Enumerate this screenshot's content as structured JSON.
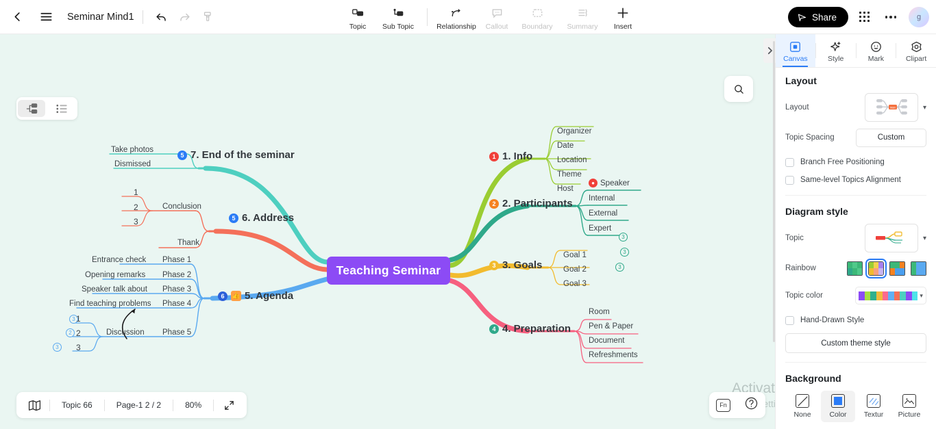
{
  "topbar": {
    "doc_title": "Seminar Mind1",
    "back_icon": "back-arrow-icon",
    "menu_icon": "hamburger-icon",
    "undo_icon": "undo-icon",
    "redo_icon": "redo-icon",
    "brush_icon": "format-painter-icon",
    "tools": [
      {
        "label": "Topic",
        "icon": "topic-icon",
        "disabled": false
      },
      {
        "label": "Sub Topic",
        "icon": "sub-topic-icon",
        "disabled": false
      },
      {
        "label": "Relationship",
        "icon": "relationship-icon",
        "disabled": false
      },
      {
        "label": "Callout",
        "icon": "callout-icon",
        "disabled": true
      },
      {
        "label": "Boundary",
        "icon": "boundary-icon",
        "disabled": true
      },
      {
        "label": "Summary",
        "icon": "summary-icon",
        "disabled": true
      },
      {
        "label": "Insert",
        "icon": "plus-icon",
        "disabled": false
      }
    ],
    "share_label": "Share",
    "share_icon": "send-icon",
    "apps_icon": "grid-apps-icon",
    "more_icon": "more-options-icon",
    "avatar_initial": "g"
  },
  "canvas": {
    "view_toggle": {
      "map_view": "map-view-icon",
      "outline_view": "outline-view-icon"
    },
    "search_icon": "search-icon",
    "central_topic": "Teaching Seminar",
    "branches": [
      {
        "number": "1",
        "title": "1. Info",
        "color": "#9acd32",
        "badge_color": "#f0403a",
        "children": [
          "Organizer",
          "Date",
          "Location",
          "Theme",
          "Host"
        ]
      },
      {
        "number": "2",
        "title": "2. Participants",
        "color": "#2fa98a",
        "badge_color": "#f58220",
        "children": [
          "Speaker",
          "Internal",
          "External",
          "Expert"
        ],
        "counts": [
          "3",
          "3",
          "3"
        ]
      },
      {
        "number": "3",
        "title": "3. Goals",
        "color": "#f2bb2e",
        "badge_color": "#f2bb2e",
        "children": [
          "Goal 1",
          "Goal 2",
          "Goal 3"
        ]
      },
      {
        "number": "4",
        "title": "4. Preparation",
        "color": "#f6607f",
        "badge_color": "#2fa98a",
        "children": [
          "Room",
          "Pen & Paper",
          "Document",
          "Refreshments"
        ]
      },
      {
        "number": "6",
        "title": "5.  Agenda",
        "color": "#5aa9f0",
        "badge_color": "#2b5fd9",
        "emoji": "👍",
        "children": [
          "Phase 1",
          "Phase 2",
          "Phase 3",
          "Phase 4",
          "Phase 5"
        ],
        "grandchildren": [
          "Entrance check",
          "Opening remarks",
          "Speaker talk about",
          "Find teaching problems",
          "Discussion"
        ],
        "numbers": [
          "1",
          "2",
          "3"
        ],
        "counts": [
          "3",
          "2",
          "3"
        ]
      },
      {
        "number": "5",
        "title": "6.  Address",
        "color": "#f4705a",
        "badge_color": "#2b7cf6",
        "children": [
          "Conclusion",
          "Thank"
        ],
        "numbers": [
          "1",
          "2",
          "3"
        ]
      },
      {
        "number": "5",
        "title": "7.  End of the seminar",
        "color": "#4ecfc0",
        "badge_color": "#2b7cf6",
        "children": [
          "Take photos",
          "Dismissed"
        ]
      }
    ]
  },
  "statusbar": {
    "map_icon": "mini-map-icon",
    "topic_count": "Topic 66",
    "page_label": "Page-1  2 / 2",
    "zoom_level": "80%",
    "fullscreen_icon": "fullscreen-icon"
  },
  "helpbar": {
    "fn_label": "Fn",
    "help_icon": "help-icon"
  },
  "watermark": {
    "line1": "Activate Windows",
    "line2": "Go to Settings to activate Windows."
  },
  "panel": {
    "collapse_icon": "chevron-right-icon",
    "tabs": [
      {
        "label": "Canvas",
        "icon": "canvas-icon",
        "active": true
      },
      {
        "label": "Style",
        "icon": "sparkle-icon",
        "active": false
      },
      {
        "label": "Mark",
        "icon": "smiley-mark-icon",
        "active": false
      },
      {
        "label": "Clipart",
        "icon": "clipart-icon",
        "active": false
      }
    ],
    "layout": {
      "heading": "Layout",
      "layout_label": "Layout",
      "layout_preview_icon": "map-layout-preview-icon",
      "spacing_label": "Topic Spacing",
      "spacing_value": "Custom",
      "checkboxes": [
        {
          "label": "Branch Free Positioning",
          "checked": false
        },
        {
          "label": "Same-level Topics Alignment",
          "checked": false
        }
      ]
    },
    "diagram_style": {
      "heading": "Diagram style",
      "topic_label": "Topic",
      "topic_preview_icon": "topic-style-preview-icon",
      "rainbow_label": "Rainbow",
      "rainbow_options": [
        {
          "name": "rainbow-green",
          "colors": [
            "#3cb878",
            "#4fc98a",
            "#3cb878",
            "#2fa98a",
            "#3cb878",
            "#4fc98a"
          ],
          "selected": false
        },
        {
          "name": "rainbow-pastel",
          "colors": [
            "#9acd32",
            "#f2d24e",
            "#a77ff0",
            "#f2bb2e",
            "#f6a07f",
            "#c9b4f0"
          ],
          "selected": true
        },
        {
          "name": "rainbow-orange",
          "colors": [
            "#3cb878",
            "#3cb878",
            "#f58220",
            "#f58220",
            "#4a9ff0",
            "#4a9ff0"
          ],
          "selected": false
        },
        {
          "name": "rainbow-blue",
          "colors": [
            "#3cb878",
            "#5aa9f0",
            "#5aa9f0",
            "#3cb878",
            "#5aa9f0",
            "#5aa9f0"
          ],
          "selected": false
        }
      ],
      "topic_color_label": "Topic color",
      "topic_colors": [
        "#8c4bf5",
        "#a6df42",
        "#2fb08e",
        "#f0bb3c",
        "#fa6a8e",
        "#5fb0f5",
        "#f4705a",
        "#4ecfc0",
        "#8c4bf5",
        "#4de3ea"
      ],
      "hand_drawn_label": "Hand-Drawn Style",
      "hand_drawn_checked": false,
      "custom_theme_label": "Custom theme style"
    },
    "background": {
      "heading": "Background",
      "options": [
        {
          "label": "None",
          "icon": "none-icon",
          "active": false
        },
        {
          "label": "Color",
          "icon": "color-fill-icon",
          "active": true
        },
        {
          "label": "Textur",
          "icon": "texture-icon",
          "active": false
        },
        {
          "label": "Picture",
          "icon": "picture-icon",
          "active": false
        }
      ]
    }
  }
}
